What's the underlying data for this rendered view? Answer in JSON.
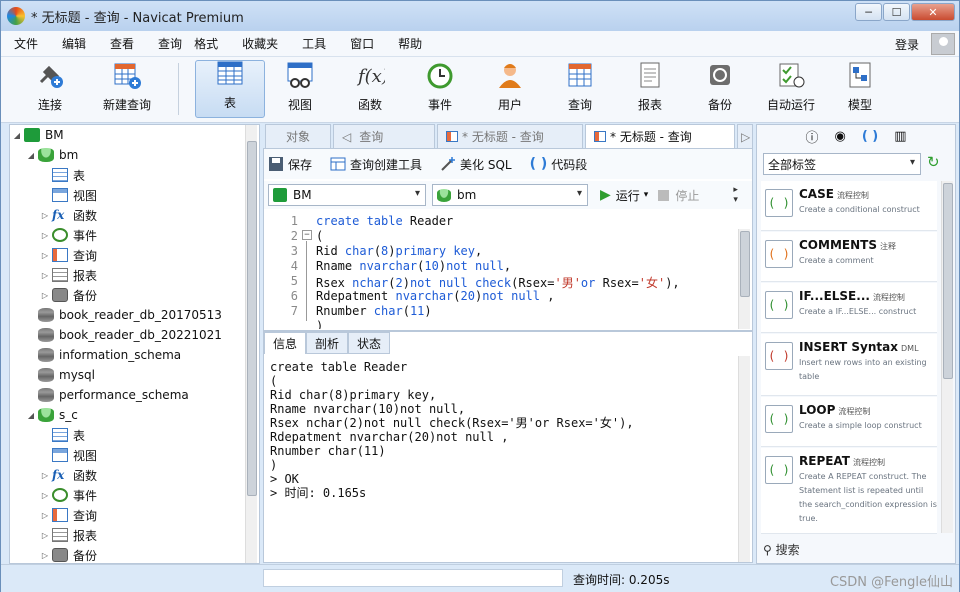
{
  "window": {
    "title": "* 无标题 - 查询 - Navicat Premium"
  },
  "menu": [
    "文件",
    "编辑",
    "查看",
    "查询",
    "格式",
    "收藏夹",
    "工具",
    "窗口",
    "帮助"
  ],
  "login": "登录",
  "toolbar": [
    "连接",
    "新建查询",
    "表",
    "视图",
    "函数",
    "事件",
    "用户",
    "查询",
    "报表",
    "备份",
    "自动运行",
    "模型"
  ],
  "tree": {
    "root": "BM",
    "db1": "bm",
    "db1_items": [
      "表",
      "视图",
      "函数",
      "事件",
      "查询",
      "报表",
      "备份"
    ],
    "dbs": [
      "book_reader_db_20170513",
      "book_reader_db_20221021",
      "information_schema",
      "mysql",
      "performance_schema"
    ],
    "db2": "s_c",
    "db2_items": [
      "表",
      "视图",
      "函数",
      "事件",
      "查询",
      "报表",
      "备份"
    ]
  },
  "tabs": [
    "对象",
    "查询",
    "* 无标题 - 查询",
    "* 无标题 - 查询"
  ],
  "editor_toolbar": [
    "保存",
    "查询创建工具",
    "美化 SQL",
    "代码段"
  ],
  "connection": {
    "conn": "BM",
    "db": "bm",
    "run": "运行",
    "stop": "停止"
  },
  "code_lines": [
    {
      "n": "1",
      "text": "create table Reader"
    },
    {
      "n": "2",
      "text": "("
    },
    {
      "n": "3",
      "text": "Rid char(8)primary key,"
    },
    {
      "n": "4",
      "text": "Rname nvarchar(10)not null,"
    },
    {
      "n": "5",
      "text": "Rsex nchar(2)not null check(Rsex='男'or Rsex='女'),"
    },
    {
      "n": "6",
      "text": "Rdepatment nvarchar(20)not null ,"
    },
    {
      "n": "7",
      "text": "Rnumber char(11)"
    },
    {
      "n": "",
      "text": ")"
    }
  ],
  "result_tabs": [
    "信息",
    "剖析",
    "状态"
  ],
  "output": [
    "create table Reader",
    "(",
    "Rid char(8)primary key,",
    "Rname nvarchar(10)not null,",
    "Rsex nchar(2)not null check(Rsex='男'or Rsex='女'),",
    "Rdepatment nvarchar(20)not null ,",
    "Rnumber char(11)",
    ")",
    "> OK",
    "> 时间: 0.165s"
  ],
  "right_panel": {
    "tag_select": "全部标签",
    "snippets": [
      {
        "title": "CASE",
        "tag": "流程控制",
        "desc": "Create a conditional construct"
      },
      {
        "title": "COMMENTS",
        "tag": "注释",
        "desc": "Create a comment"
      },
      {
        "title": "IF...ELSE...",
        "tag": "流程控制",
        "desc": "Create a IF...ELSE... construct"
      },
      {
        "title": "INSERT Syntax",
        "tag": "DML",
        "desc": "Insert new rows into an existing table"
      },
      {
        "title": "LOOP",
        "tag": "流程控制",
        "desc": "Create a simple loop construct"
      },
      {
        "title": "REPEAT",
        "tag": "流程控制",
        "desc": "Create A REPEAT construct. The Statement list is repeated until the search_condition expression is true."
      }
    ],
    "search": "搜索"
  },
  "status": {
    "query_time": "查询时间: 0.205s",
    "watermark": "CSDN @Fengle仙山"
  }
}
